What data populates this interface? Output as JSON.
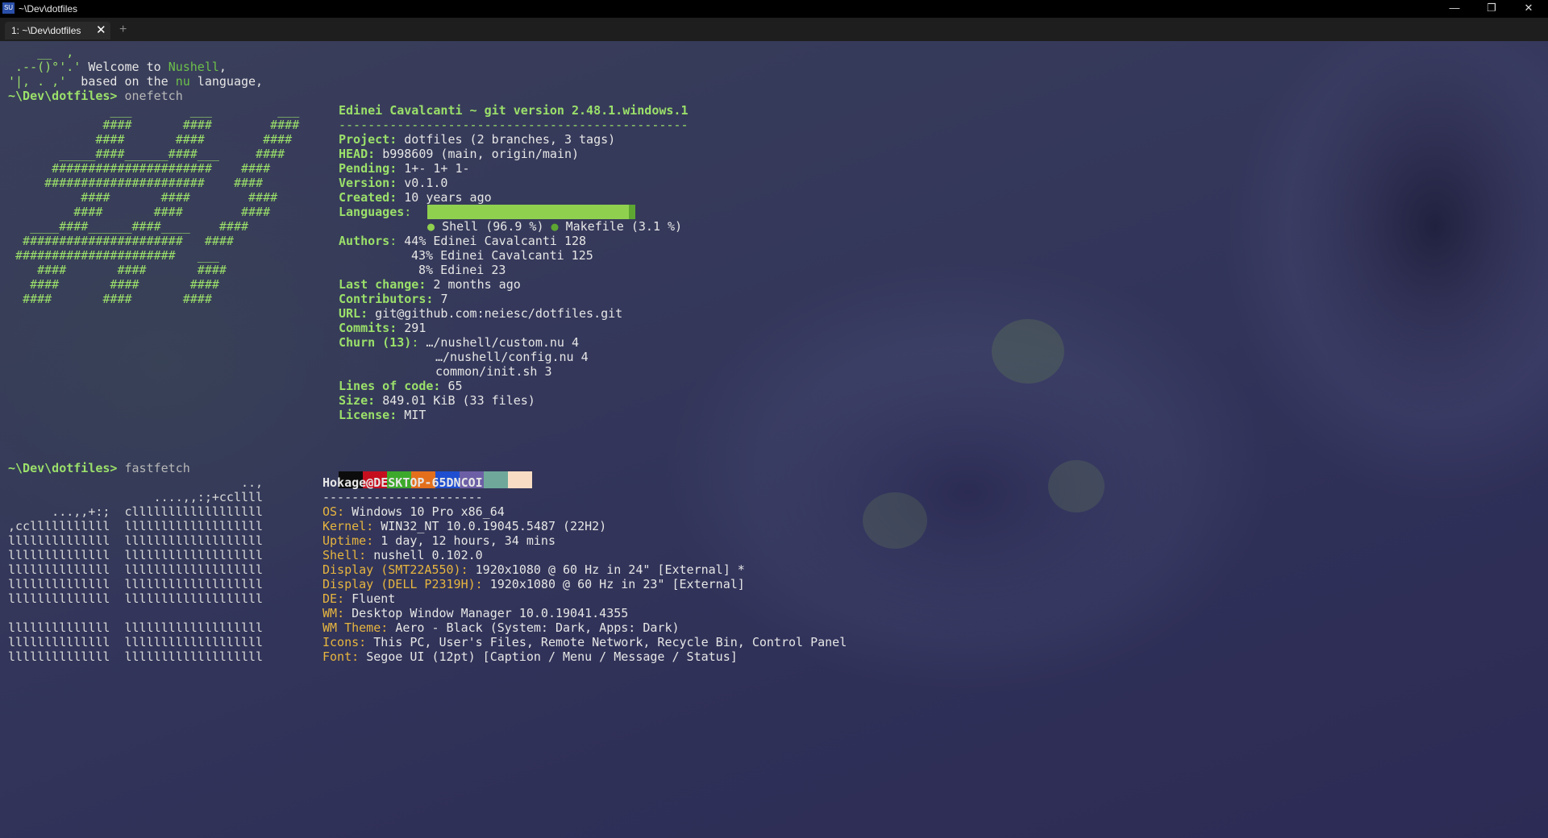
{
  "window": {
    "title": "~\\Dev\\dotfiles",
    "app_icon": "SU",
    "minimize_icon": "—",
    "maximize_icon": "❐",
    "close_icon": "✕"
  },
  "tabs": [
    {
      "label": "1: ~\\Dev\\dotfiles",
      "close": "✕",
      "active": true
    }
  ],
  "new_tab_label": "+",
  "welcome": {
    "art1": "    __  ,",
    "art2": " .--()°'.'",
    "art3": "'|, . ,'",
    "text2a": " Welcome to ",
    "text2b": "Nushell",
    "text2c": ",",
    "text3a": "  based on the ",
    "text3b": "nu",
    "text3c": " language,"
  },
  "prompt": "~\\Dev\\dotfiles>",
  "commands": [
    "onefetch",
    "fastfetch"
  ],
  "onefetch": {
    "logo": [
      "              ___        ___         ___",
      "             ####       ####        ####",
      "            ####       ####        ####",
      "       _____####______####___     ####",
      "      ######################    ####",
      "     ######################    ####",
      "          ####       ####        ####",
      "         ####       ####        ####",
      "   ____####______####____    ####",
      "  ######################   ####",
      " ######################   ___",
      "    ####       ####       ####",
      "   ####       ####       ####",
      "  ####       ####       ####"
    ],
    "header": "Edinei Cavalcanti ~ git version 2.48.1.windows.1",
    "separator": "------------------------------------------------",
    "rows": [
      {
        "key": "Project",
        "value": "dotfiles (2 branches, 3 tags)"
      },
      {
        "key": "HEAD",
        "value": "b998609 (main, origin/main)"
      },
      {
        "key": "Pending",
        "value": "1+- 1+ 1-"
      },
      {
        "key": "Version",
        "value": "v0.1.0"
      },
      {
        "key": "Created",
        "value": "10 years ago"
      }
    ],
    "languages_key": "Languages",
    "languages": [
      {
        "bullet": "●",
        "name": "Shell (96.9 %)",
        "percent": 96.9,
        "color": "#8fd14f"
      },
      {
        "bullet": "●",
        "name": "Makefile (3.1 %)",
        "percent": 3.1,
        "color": "#5da632"
      }
    ],
    "authors_key": "Authors",
    "authors": [
      "44% Edinei Cavalcanti 128",
      "43% Edinei Cavalcanti 125",
      " 8% Edinei 23"
    ],
    "rows2": [
      {
        "key": "Last change",
        "value": "2 months ago"
      },
      {
        "key": "Contributors",
        "value": "7"
      },
      {
        "key": "URL",
        "value": "git@github.com:neiesc/dotfiles.git"
      },
      {
        "key": "Commits",
        "value": "291"
      }
    ],
    "churn_key": "Churn (13)",
    "churn": [
      "…/nushell/custom.nu 4",
      "…/nushell/config.nu 4",
      "common/init.sh 3"
    ],
    "rows3": [
      {
        "key": "Lines of code",
        "value": "65"
      },
      {
        "key": "Size",
        "value": "849.01 KiB (33 files)"
      },
      {
        "key": "License",
        "value": "MIT"
      }
    ],
    "palette": [
      "#0c0c0c",
      "#c50f1f",
      "#3ca92c",
      "#e36f1c",
      "#1f4fd0",
      "#6d5fa6",
      "#6fa89a",
      "#f9dcc4"
    ]
  },
  "fastfetch": {
    "logo": [
      "                                ..,",
      "                    ....,,:;+ccllll",
      "      ...,,+:;  cllllllllllllllllll",
      ",cclllllllllll  lllllllllllllllllll",
      "llllllllllllll  lllllllllllllllllll",
      "llllllllllllll  lllllllllllllllllll",
      "llllllllllllll  lllllllllllllllllll",
      "llllllllllllll  lllllllllllllllllll",
      "llllllllllllll  lllllllllllllllllll",
      "",
      "llllllllllllll  lllllllllllllllllll",
      "llllllllllllll  lllllllllllllllllll",
      "llllllllllllll  lllllllllllllllllll"
    ],
    "header": "Hokage@DESKTOP-65DNCOI",
    "separator": "----------------------",
    "rows": [
      {
        "key": "OS",
        "value": "Windows 10 Pro x86_64"
      },
      {
        "key": "Kernel",
        "value": "WIN32_NT 10.0.19045.5487 (22H2)"
      },
      {
        "key": "Uptime",
        "value": "1 day, 12 hours, 34 mins"
      },
      {
        "key": "Shell",
        "value": "nushell 0.102.0"
      },
      {
        "key": "Display (SMT22A550)",
        "value": "1920x1080 @ 60 Hz in 24\" [External] *"
      },
      {
        "key": "Display (DELL P2319H)",
        "value": "1920x1080 @ 60 Hz in 23\" [External]"
      },
      {
        "key": "DE",
        "value": "Fluent"
      },
      {
        "key": "WM",
        "value": "Desktop Window Manager 10.0.19041.4355"
      },
      {
        "key": "WM Theme",
        "value": "Aero - Black (System: Dark, Apps: Dark)"
      },
      {
        "key": "Icons",
        "value": "This PC, User's Files, Remote Network, Recycle Bin, Control Panel"
      },
      {
        "key": "Font",
        "value": "Segoe UI (12pt) [Caption / Menu / Message / Status]"
      }
    ]
  }
}
